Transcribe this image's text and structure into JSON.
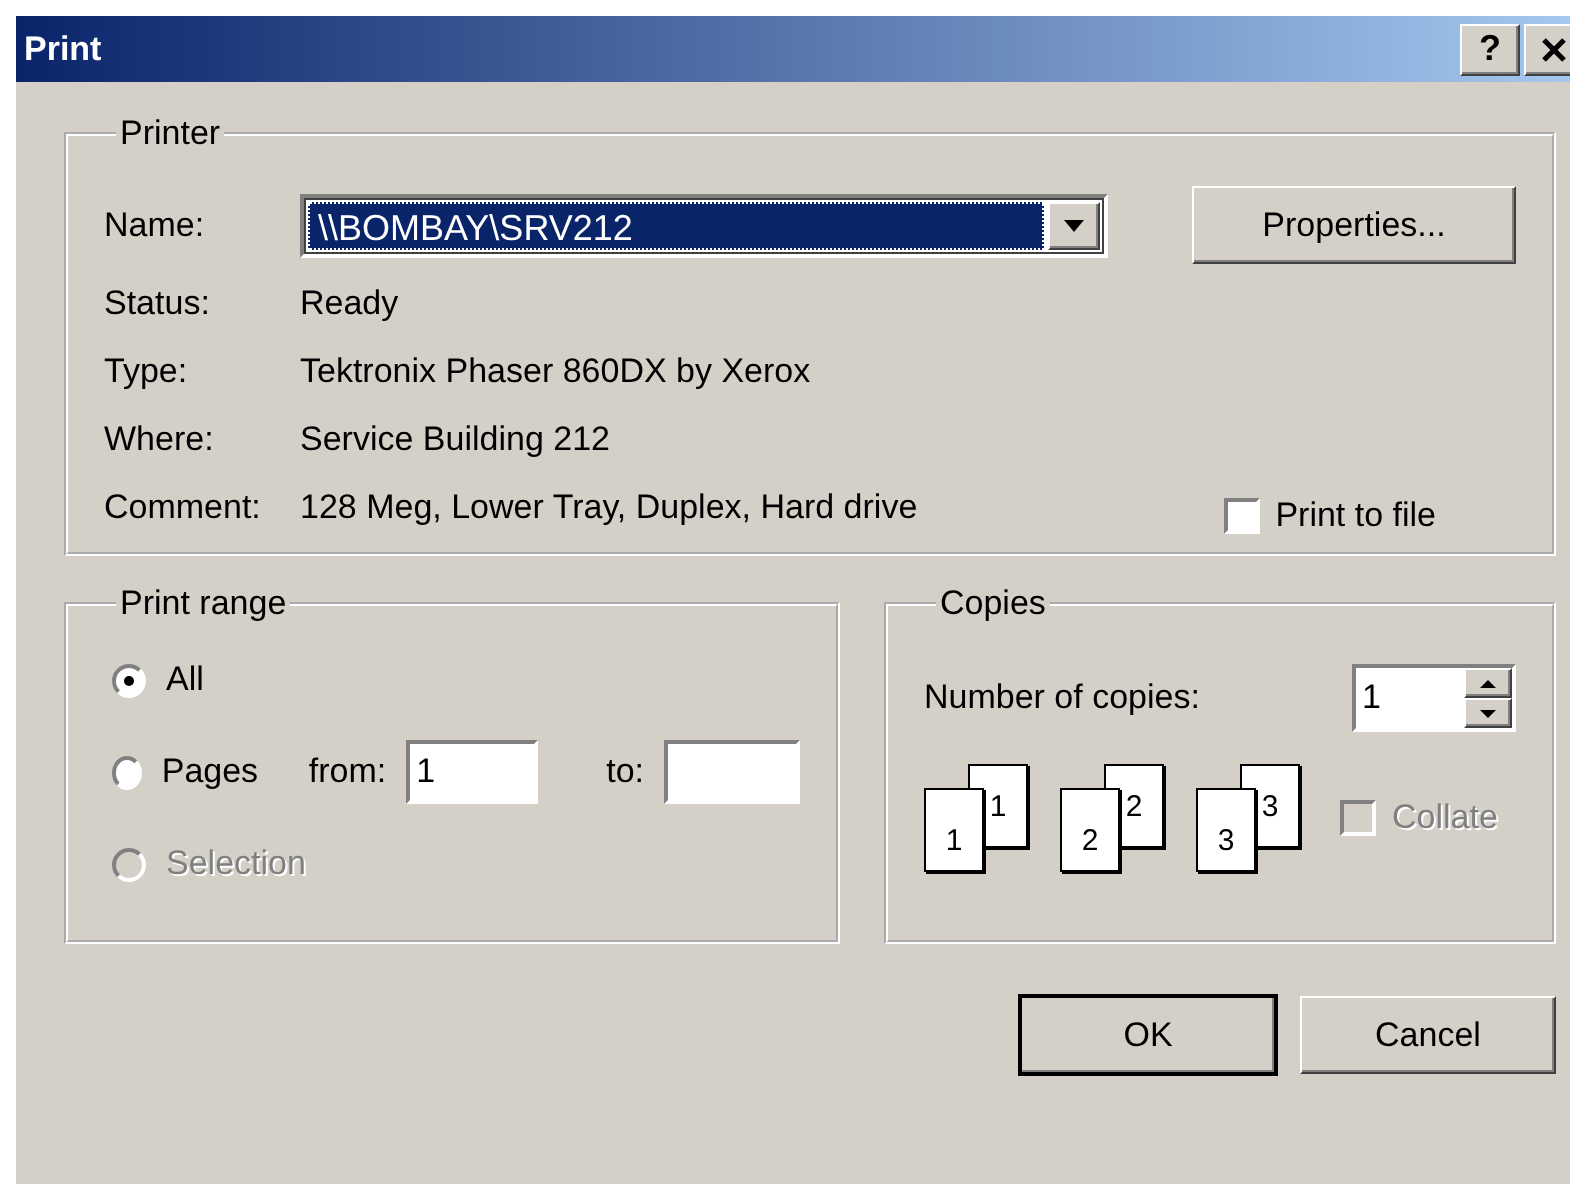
{
  "window": {
    "title": "Print",
    "help": "?"
  },
  "printer": {
    "legend": "Printer",
    "name_label": "Name:",
    "name_value": "\\\\BOMBAY\\SRV212",
    "properties": "Properties...",
    "info": [
      {
        "label": "Status:",
        "value": "Ready"
      },
      {
        "label": "Type:",
        "value": "Tektronix Phaser 860DX by Xerox"
      },
      {
        "label": "Where:",
        "value": "Service Building 212"
      },
      {
        "label": "Comment:",
        "value": "128 Meg, Lower Tray, Duplex, Hard drive"
      }
    ],
    "print_to_file": {
      "label": "Print to file",
      "checked": false
    }
  },
  "print_range": {
    "legend": "Print range",
    "options": [
      {
        "label": "All",
        "selected": true,
        "disabled": false
      },
      {
        "label": "Pages",
        "selected": false,
        "disabled": false,
        "from_label": "from:",
        "from_value": "1",
        "to_label": "to:"
      },
      {
        "label": "Selection",
        "selected": false,
        "disabled": true
      }
    ]
  },
  "copies": {
    "legend": "Copies",
    "count_label": "Number of copies:",
    "count_value": "1",
    "pages": [
      {
        "front": "1",
        "back": "1"
      },
      {
        "front": "2",
        "back": "2"
      },
      {
        "front": "3",
        "back": "3"
      }
    ],
    "collate": {
      "label": "Collate",
      "checked": false,
      "disabled": true
    }
  },
  "buttons": [
    {
      "label": "OK",
      "default": true
    },
    {
      "label": "Cancel",
      "default": false
    }
  ]
}
